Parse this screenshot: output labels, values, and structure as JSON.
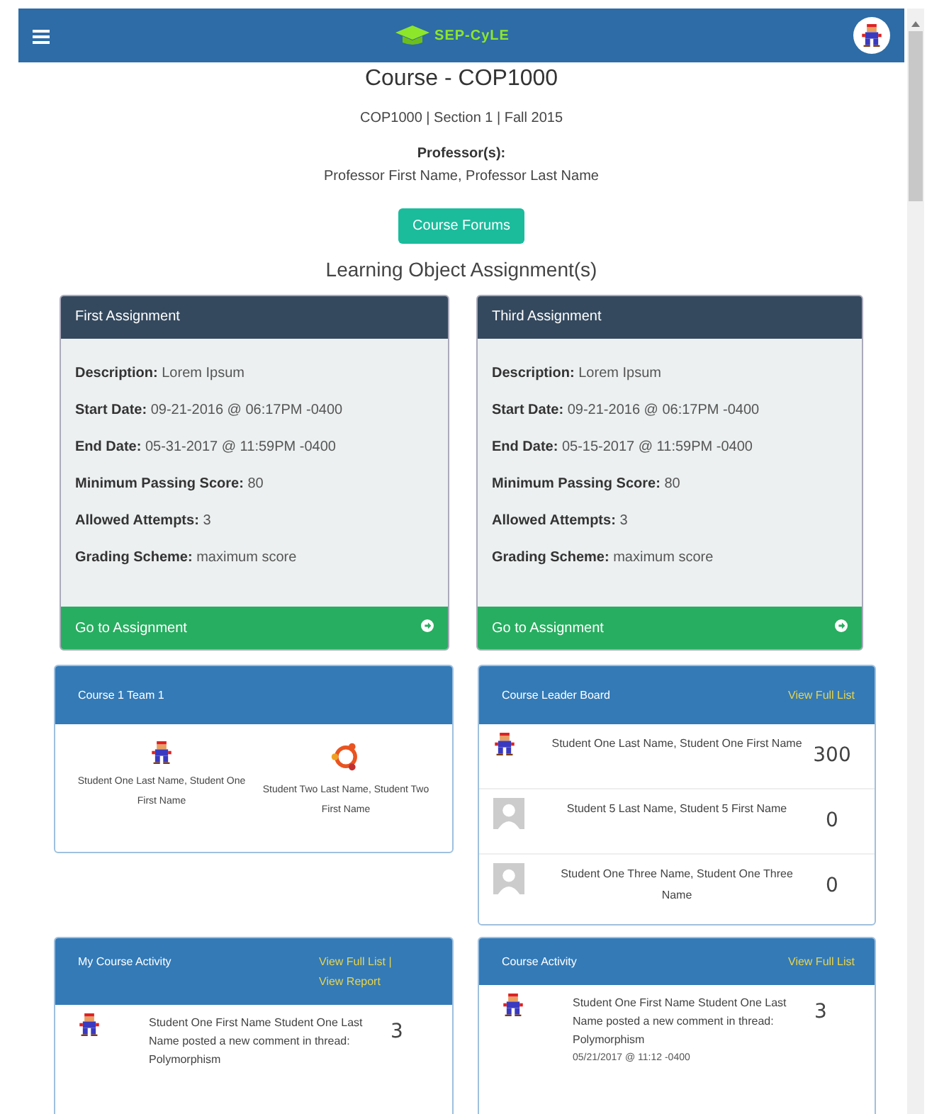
{
  "header": {
    "brand": "SEP-CyLE"
  },
  "course": {
    "title": "Course - COP1000",
    "meta": "COP1000 | Section 1 | Fall 2015",
    "professors_label": "Professor(s):",
    "professors": "Professor First Name, Professor Last Name"
  },
  "forums_button": "Course Forums",
  "section_title": "Learning Object Assignment(s)",
  "assignments": [
    {
      "title": "First Assignment",
      "fields": [
        {
          "label": "Description:",
          "value": "Lorem Ipsum"
        },
        {
          "label": "Start Date:",
          "value": "09-21-2016 @ 06:17PM -0400"
        },
        {
          "label": "End Date:",
          "value": "05-31-2017 @ 11:59PM -0400"
        },
        {
          "label": "Minimum Passing Score:",
          "value": "80"
        },
        {
          "label": "Allowed Attempts:",
          "value": "3"
        },
        {
          "label": "Grading Scheme:",
          "value": "maximum score"
        }
      ],
      "action": "Go to Assignment"
    },
    {
      "title": "Third Assignment",
      "fields": [
        {
          "label": "Description:",
          "value": "Lorem Ipsum"
        },
        {
          "label": "Start Date:",
          "value": "09-21-2016 @ 06:17PM -0400"
        },
        {
          "label": "End Date:",
          "value": "05-15-2017 @ 11:59PM -0400"
        },
        {
          "label": "Minimum Passing Score:",
          "value": "80"
        },
        {
          "label": "Allowed Attempts:",
          "value": "3"
        },
        {
          "label": "Grading Scheme:",
          "value": "maximum score"
        }
      ],
      "action": "Go to Assignment"
    }
  ],
  "team": {
    "title": "Course 1 Team 1",
    "members": [
      {
        "name": "Student One Last Name, Student One First Name",
        "kind": "figure"
      },
      {
        "name": "Student Two Last Name, Student Two First Name",
        "kind": "ring"
      }
    ]
  },
  "leaderboard": {
    "title": "Course Leader Board",
    "links": [
      "View Full List"
    ],
    "rows": [
      {
        "name": "Student One Last Name, Student One First Name",
        "score": "300",
        "kind": "figure"
      },
      {
        "name": "Student 5 Last Name, Student 5 First Name",
        "score": "0",
        "kind": "placeholder"
      },
      {
        "name": "Student One Three Name, Student One Three Name",
        "score": "0",
        "kind": "placeholder"
      }
    ]
  },
  "activities": [
    {
      "title": "My Course Activity",
      "links": [
        "View Full List",
        "View Report"
      ],
      "separator": "|",
      "items": [
        {
          "kind": "figure",
          "text": "Student One First Name Student One Last Name posted a new comment in thread: Polymorphism",
          "count": "3"
        }
      ]
    },
    {
      "title": "Course Activity",
      "links": [
        "View Full List"
      ],
      "items": [
        {
          "kind": "figure",
          "text": "Student One First Name Student One Last Name posted a new comment in thread: Polymorphism",
          "count": "3",
          "time": "05/21/2017 @ 11:12 -0400"
        }
      ]
    }
  ]
}
